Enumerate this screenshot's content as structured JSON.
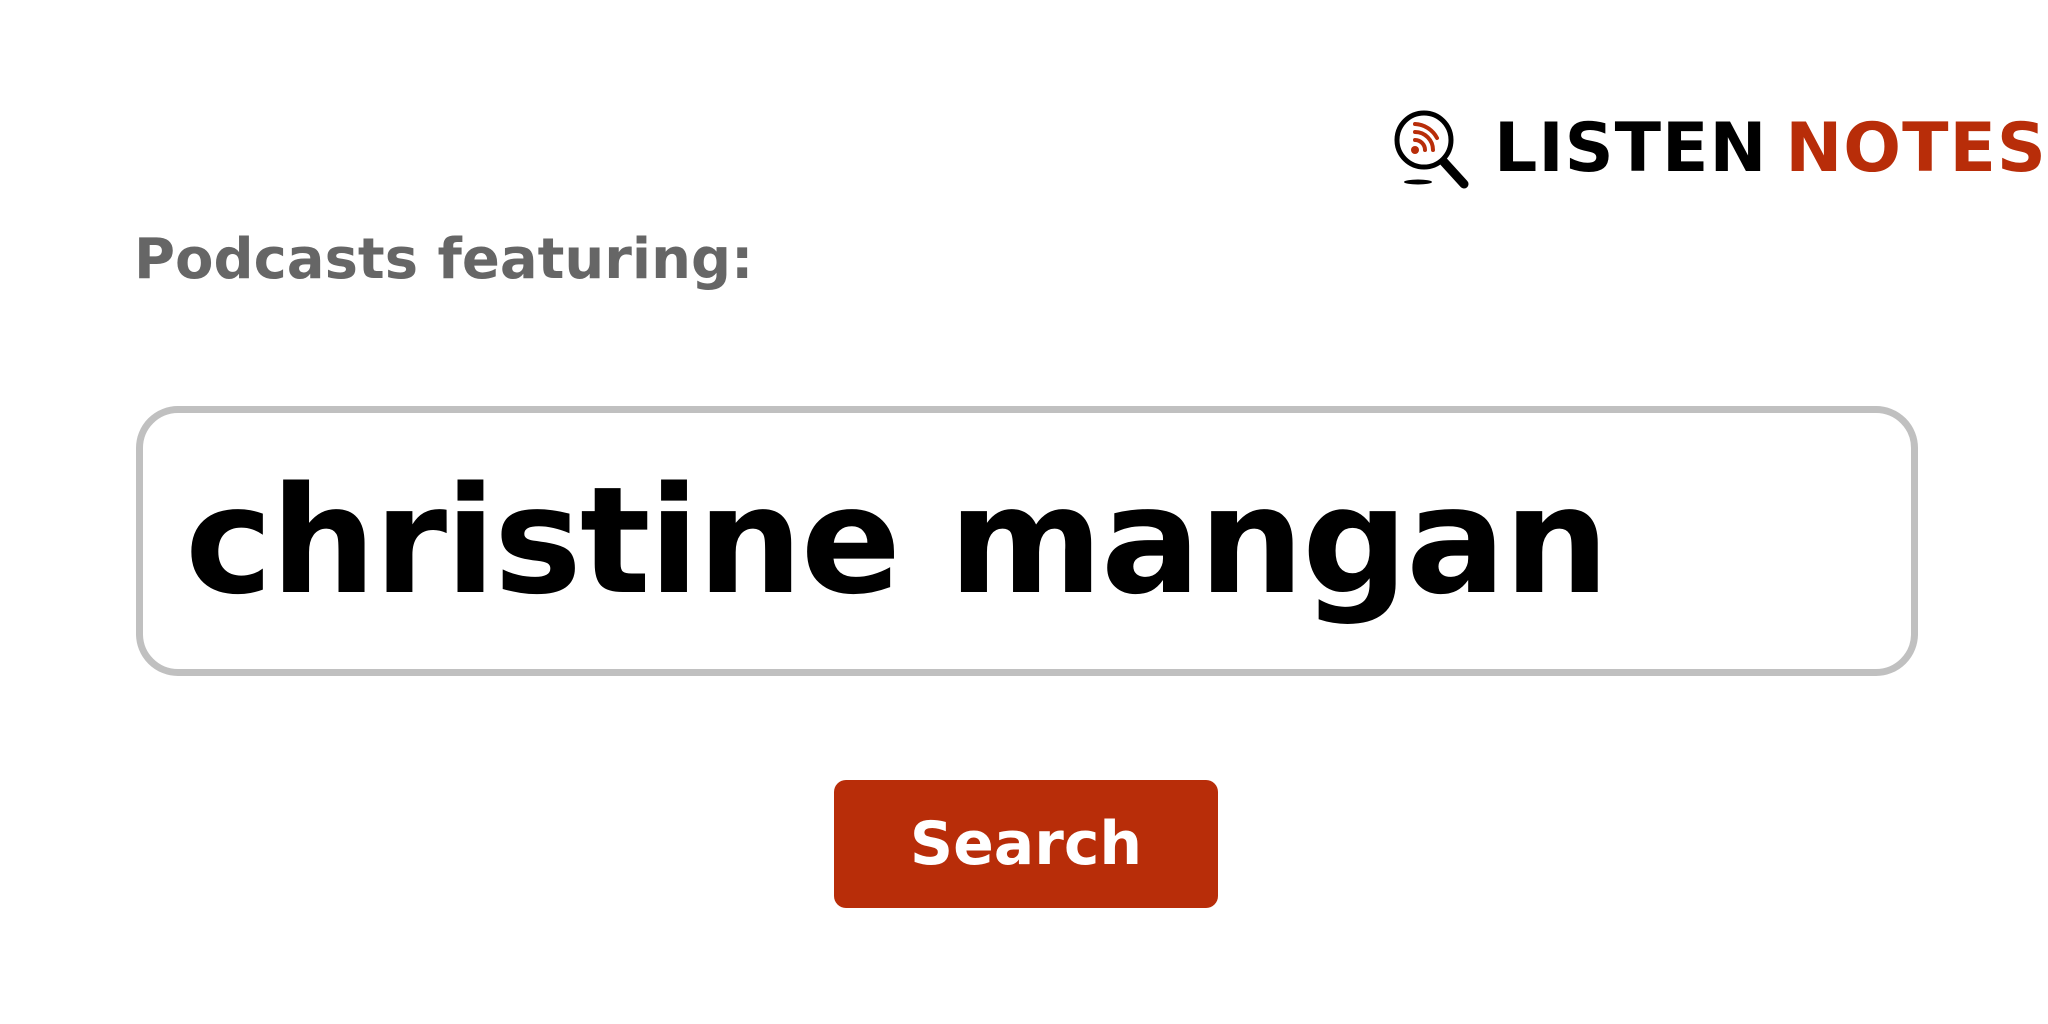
{
  "logo": {
    "icon": "podcast-search-icon",
    "word1": "LISTEN",
    "word2": "NOTES",
    "colors": {
      "primary": "#000000",
      "accent": "#b82d09"
    }
  },
  "heading": {
    "text": "Podcasts featuring:",
    "color": "#666666"
  },
  "search": {
    "value": "christine mangan",
    "border_color": "#c0c0c0"
  },
  "button": {
    "label": "Search",
    "color": "#b82d09"
  }
}
